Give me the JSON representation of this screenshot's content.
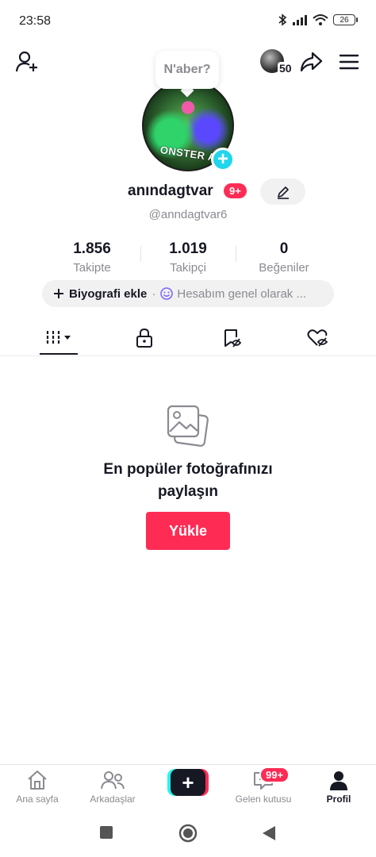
{
  "status_bar": {
    "time": "23:58",
    "battery": "26"
  },
  "top_bar": {
    "profile_views": "50"
  },
  "profile": {
    "bubble_text": "N'aber?",
    "avatar_text": "ONSTER A",
    "username": "anındagtvar",
    "notification_badge": "9+",
    "handle": "@anndagtvar6"
  },
  "stats": [
    {
      "value": "1.856",
      "label": "Takipte"
    },
    {
      "value": "1.019",
      "label": "Takipçi"
    },
    {
      "value": "0",
      "label": "Beğeniler"
    }
  ],
  "bio": {
    "add_label": "Biyografi ekle",
    "status_text": "Hesabım genel olarak ..."
  },
  "empty_state": {
    "title_line1": "En popüler fotoğrafınızı",
    "title_line2": "paylaşın",
    "button": "Yükle"
  },
  "bottom_nav": {
    "home": "Ana sayfa",
    "friends": "Arkadaşlar",
    "inbox": "Gelen kutusu",
    "inbox_badge": "99+",
    "profile": "Profil"
  },
  "colors": {
    "accent": "#fe2c55",
    "cyan": "#20d5ec",
    "text": "#161823",
    "muted": "#8a8b91"
  }
}
